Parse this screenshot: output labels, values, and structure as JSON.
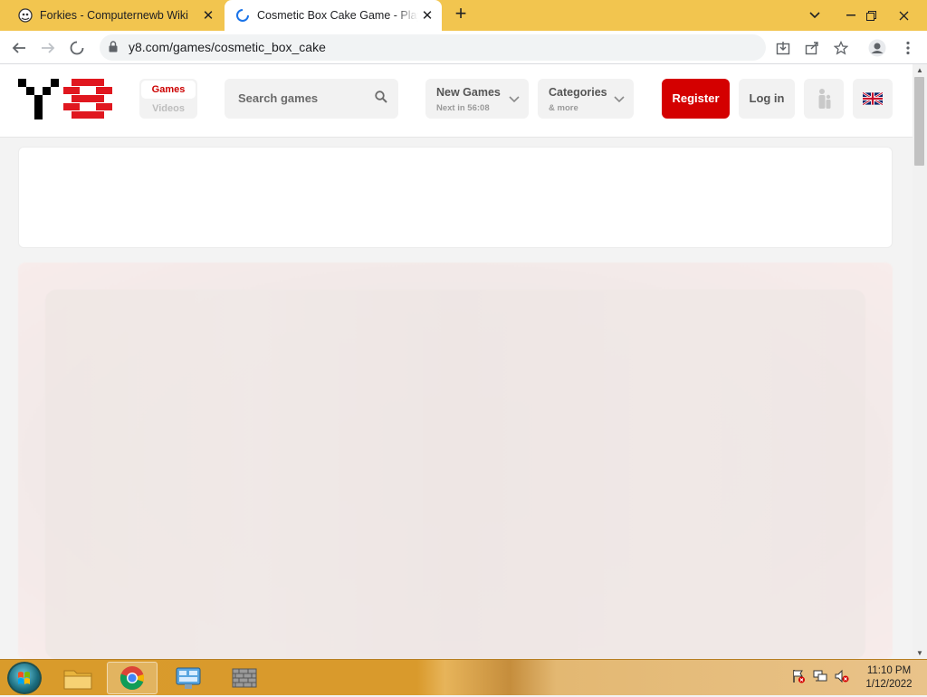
{
  "browser": {
    "tabs": [
      {
        "title": "Forkies - Computernewb Wiki",
        "active": false
      },
      {
        "title": "Cosmetic Box Cake Game - Play Online",
        "active": true
      }
    ],
    "url": "y8.com/games/cosmetic_box_cake"
  },
  "site": {
    "toggle": {
      "games": "Games",
      "videos": "Videos"
    },
    "search_placeholder": "Search games",
    "new_games": {
      "title": "New Games",
      "sub": "Next in 56:08"
    },
    "categories": {
      "title": "Categories",
      "sub": "& more"
    },
    "register": "Register",
    "login": "Log in",
    "brand_color": "#d40000"
  },
  "taskbar": {
    "time": "11:10 PM",
    "date": "1/12/2022"
  }
}
